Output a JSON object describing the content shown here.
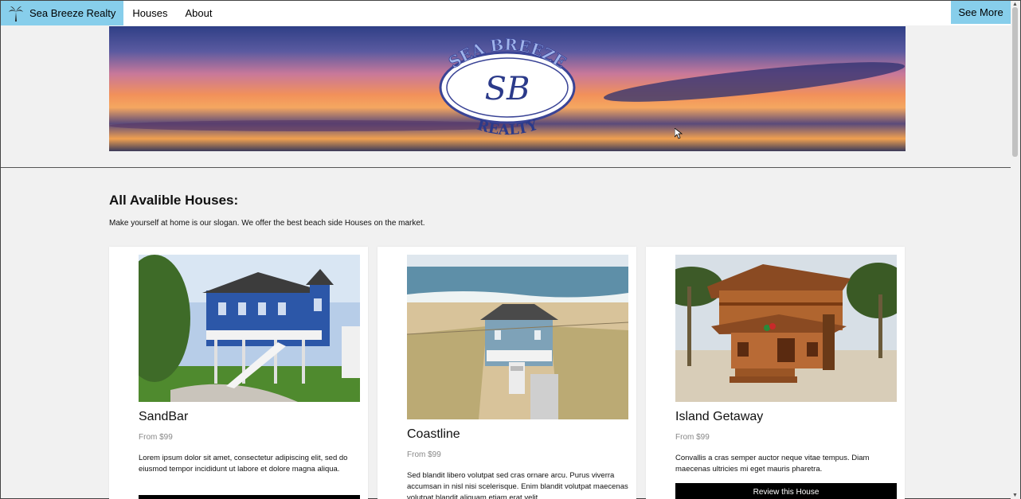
{
  "nav": {
    "brand": "Sea Breeze Realty",
    "links": [
      "Houses",
      "About"
    ],
    "right_button": "See More",
    "brand_icon": "palm-tree-icon"
  },
  "banner": {
    "logo_top": "SEA BREEZE",
    "logo_monogram": "SB",
    "logo_bottom": "REALTY"
  },
  "section": {
    "title": "All Avalible Houses:",
    "subtitle": "Make yourself at home is our slogan. We offer the best beach side Houses on the market."
  },
  "cards": [
    {
      "title": "SandBar",
      "price": "From $99",
      "description": "Lorem ipsum dolor sit amet, consectetur adipiscing elit, sed do eiusmod tempor incididunt ut labore et dolore magna aliqua.",
      "button": ""
    },
    {
      "title": "Coastline",
      "price": "From $99",
      "description": "Sed blandit libero volutpat sed cras ornare arcu. Purus viverra accumsan in nisl nisi scelerisque. Enim blandit volutpat maecenas volutpat blandit aliquam etiam erat velit.",
      "button": ""
    },
    {
      "title": "Island Getaway",
      "price": "From $99",
      "description": "Convallis a cras semper auctor neque vitae tempus. Diam maecenas ultricies mi eget mauris pharetra.",
      "button": "Review this House"
    }
  ],
  "colors": {
    "accent": "#87ceeb",
    "background": "#f1f1f1",
    "button": "#000000"
  }
}
